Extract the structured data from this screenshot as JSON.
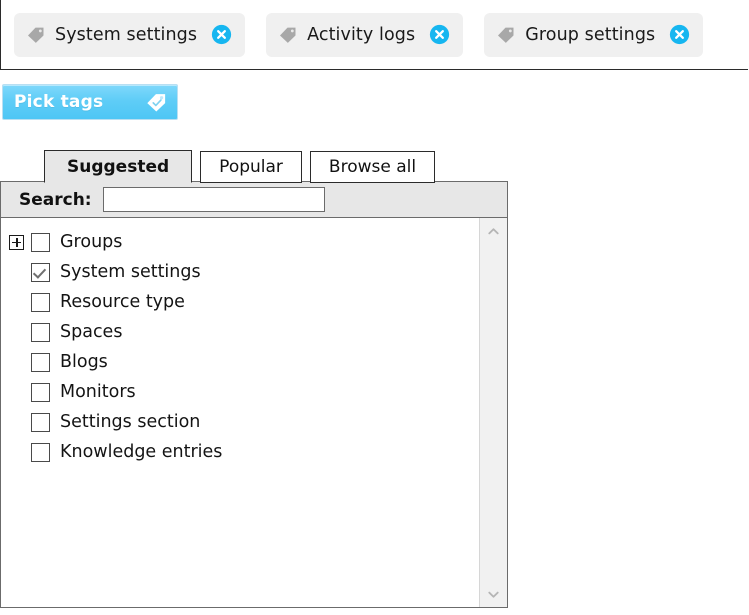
{
  "selected_tags": {
    "tag_icon_name": "tag-icon",
    "close_icon_name": "remove-tag-icon",
    "items": [
      {
        "label": "System settings"
      },
      {
        "label": "Activity logs"
      },
      {
        "label": "Group settings"
      }
    ]
  },
  "pick_tags_button": {
    "label": "Pick tags",
    "icon": "tag-check-icon",
    "background_start": "#7fd8fb",
    "background_end": "#4ec6f5",
    "text_color": "#ffffff"
  },
  "tabs": [
    {
      "label": "Suggested",
      "active": true
    },
    {
      "label": "Popular",
      "active": false
    },
    {
      "label": "Browse all",
      "active": false
    }
  ],
  "search": {
    "label": "Search:",
    "value": "",
    "placeholder": ""
  },
  "tag_list": {
    "items": [
      {
        "label": "Groups",
        "checked": false,
        "expandable": true
      },
      {
        "label": "System settings",
        "checked": true,
        "expandable": false
      },
      {
        "label": "Resource type",
        "checked": false,
        "expandable": false
      },
      {
        "label": "Spaces",
        "checked": false,
        "expandable": false
      },
      {
        "label": "Blogs",
        "checked": false,
        "expandable": false
      },
      {
        "label": "Monitors",
        "checked": false,
        "expandable": false
      },
      {
        "label": "Settings section",
        "checked": false,
        "expandable": false
      },
      {
        "label": "Knowledge entries",
        "checked": false,
        "expandable": false
      }
    ]
  },
  "scrollbar": {
    "up_icon": "chevron-up-icon",
    "down_icon": "chevron-down-icon"
  }
}
